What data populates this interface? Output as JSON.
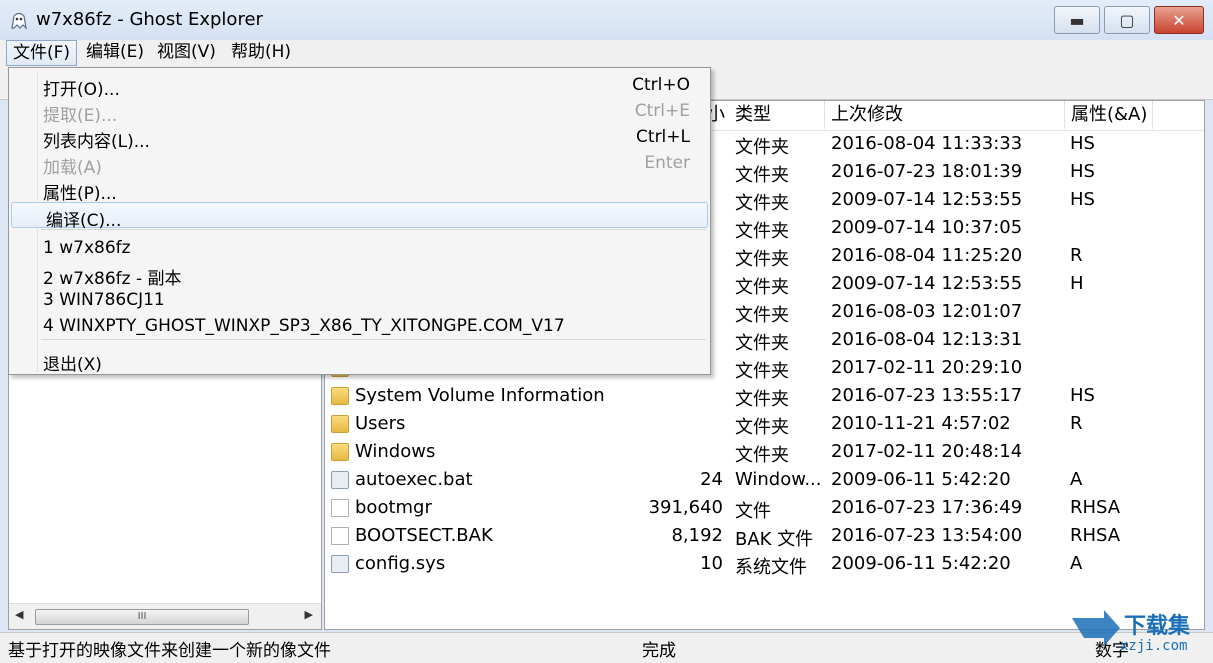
{
  "window": {
    "title": "w7x86fz - Ghost Explorer",
    "minimize": "▬",
    "maximize": "▢",
    "close": "✕"
  },
  "menubar": {
    "file": "文件(F)",
    "edit": "编辑(E)",
    "view": "视图(V)",
    "help": "帮助(H)"
  },
  "file_menu": {
    "items": [
      {
        "label": "打开(O)...",
        "shortcut": "Ctrl+O",
        "enabled": true
      },
      {
        "label": "提取(E)...",
        "shortcut": "Ctrl+E",
        "enabled": false
      },
      {
        "label": "列表内容(L)...",
        "shortcut": "Ctrl+L",
        "enabled": true
      },
      {
        "label": "加载(A)",
        "shortcut": "Enter",
        "enabled": false
      },
      {
        "label": "属性(P)...",
        "shortcut": "",
        "enabled": true
      },
      {
        "label": "编译(C)...",
        "shortcut": "",
        "enabled": true,
        "highlighted": true
      }
    ],
    "recent": [
      "1 w7x86fz",
      "2 w7x86fz - 副本",
      "3 WIN786CJ11",
      "4 WINXPTY_GHOST_WINXP_SP3_X86_TY_XITONGPE.COM_V17"
    ],
    "exit": "退出(X)"
  },
  "columns": {
    "size_partial": "小",
    "type": "类型",
    "modified": "上次修改",
    "attributes": "属性(&A)"
  },
  "files": [
    {
      "name": "",
      "size": "",
      "type": "文件夹",
      "modified": "2016-08-04 11:33:33",
      "attr": "HS",
      "icon": "folder"
    },
    {
      "name": "",
      "size": "",
      "type": "文件夹",
      "modified": "2016-07-23 18:01:39",
      "attr": "HS",
      "icon": "folder"
    },
    {
      "name": "",
      "size": "",
      "type": "文件夹",
      "modified": "2009-07-14 12:53:55",
      "attr": "HS",
      "icon": "folder"
    },
    {
      "name": "",
      "size": "",
      "type": "文件夹",
      "modified": "2009-07-14 10:37:05",
      "attr": "",
      "icon": "folder"
    },
    {
      "name": "",
      "size": "",
      "type": "文件夹",
      "modified": "2016-08-04 11:25:20",
      "attr": "R",
      "icon": "folder"
    },
    {
      "name": "",
      "size": "",
      "type": "文件夹",
      "modified": "2009-07-14 12:53:55",
      "attr": "H",
      "icon": "folder"
    },
    {
      "name": "",
      "size": "",
      "type": "文件夹",
      "modified": "2016-08-03 12:01:07",
      "attr": "",
      "icon": "folder"
    },
    {
      "name": "",
      "size": "",
      "type": "文件夹",
      "modified": "2016-08-04 12:13:31",
      "attr": "",
      "icon": "folder"
    },
    {
      "name": "",
      "size": "",
      "type": "文件夹",
      "modified": "2017-02-11 20:29:10",
      "attr": "",
      "icon": "folder"
    },
    {
      "name": "System Volume Information",
      "size": "",
      "type": "文件夹",
      "modified": "2016-07-23 13:55:17",
      "attr": "HS",
      "icon": "folder"
    },
    {
      "name": "Users",
      "size": "",
      "type": "文件夹",
      "modified": "2010-11-21 4:57:02",
      "attr": "R",
      "icon": "folder"
    },
    {
      "name": "Windows",
      "size": "",
      "type": "文件夹",
      "modified": "2017-02-11 20:48:14",
      "attr": "",
      "icon": "folder"
    },
    {
      "name": "autoexec.bat",
      "size": "24",
      "type": "Window...",
      "modified": "2009-06-11 5:42:20",
      "attr": "A",
      "icon": "bat"
    },
    {
      "name": "bootmgr",
      "size": "391,640",
      "type": "文件",
      "modified": "2016-07-23 17:36:49",
      "attr": "RHSA",
      "icon": "file"
    },
    {
      "name": "BOOTSECT.BAK",
      "size": "8,192",
      "type": "BAK 文件",
      "modified": "2016-07-23 13:54:00",
      "attr": "RHSA",
      "icon": "file"
    },
    {
      "name": "config.sys",
      "size": "10",
      "type": "系统文件",
      "modified": "2009-06-11 5:42:20",
      "attr": "A",
      "icon": "bat"
    }
  ],
  "left_scroll": {
    "left_arrow": "◀",
    "thumb": "III",
    "right_arrow": "▶"
  },
  "status": {
    "left": "基于打开的映像文件来创建一个新的像文件",
    "middle": "完成",
    "right": "数字"
  },
  "watermark": {
    "text": "下载集",
    "sub": "xzji.com"
  }
}
